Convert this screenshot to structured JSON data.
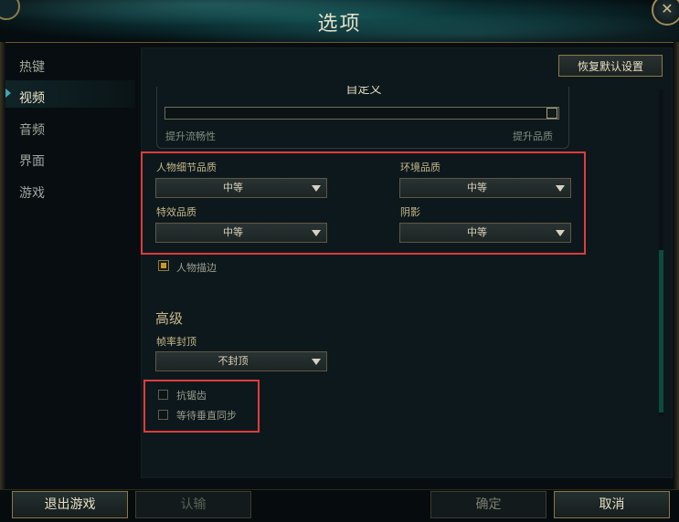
{
  "window": {
    "title": "选项"
  },
  "sidebar": {
    "items": [
      {
        "label": "热键"
      },
      {
        "label": "视频"
      },
      {
        "label": "音频"
      },
      {
        "label": "界面"
      },
      {
        "label": "游戏"
      }
    ],
    "active": "视频"
  },
  "header": {
    "restore_defaults": "恢复默认设置"
  },
  "quality": {
    "preset_label": "自定义",
    "slider_left": "提升流畅性",
    "slider_right": "提升品质",
    "slider_value_fraction": 1.0
  },
  "settings": {
    "character_detail": {
      "label": "人物细节品质",
      "value": "中等"
    },
    "environment": {
      "label": "环境品质",
      "value": "中等"
    },
    "effects": {
      "label": "特效品质",
      "value": "中等"
    },
    "shadows": {
      "label": "阴影",
      "value": "中等"
    },
    "outline": {
      "label": "人物描边",
      "checked": true
    }
  },
  "advanced": {
    "title": "高级",
    "frame_cap": {
      "label": "帧率封顶",
      "value": "不封顶"
    },
    "anti_aliasing": {
      "label": "抗锯齿",
      "checked": false
    },
    "vsync": {
      "label": "等待垂直同步",
      "checked": false
    }
  },
  "footer": {
    "exit_game": "退出游戏",
    "surrender": "认输",
    "confirm": "确定",
    "cancel": "取消"
  },
  "colors": {
    "accent_gold": "#c9b98a",
    "highlight_red": "#e03b3b",
    "scroll_teal": "#0d4a40"
  }
}
